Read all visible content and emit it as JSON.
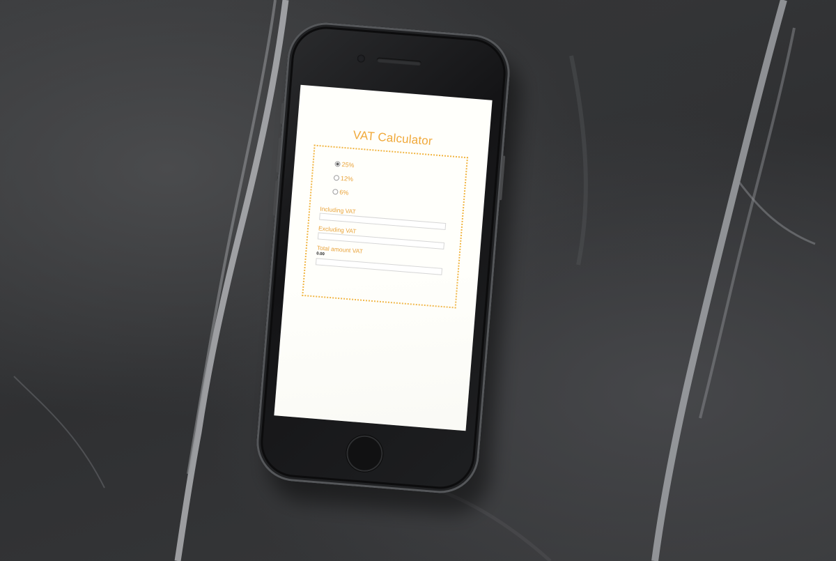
{
  "app": {
    "title": "VAT Calculator"
  },
  "vat_rates": [
    {
      "label": "25%",
      "selected": true
    },
    {
      "label": "12%",
      "selected": false
    },
    {
      "label": "6%",
      "selected": false
    }
  ],
  "fields": {
    "including_vat": {
      "label": "Including VAT",
      "value": ""
    },
    "excluding_vat": {
      "label": "Excluding VAT",
      "value": ""
    },
    "total_amount_vat": {
      "label": "Total amount VAT",
      "value": "0.00"
    }
  },
  "colors": {
    "accent": "#f0a93a",
    "screen_bg": "#fffffb",
    "surface": "#3a3b3d"
  }
}
